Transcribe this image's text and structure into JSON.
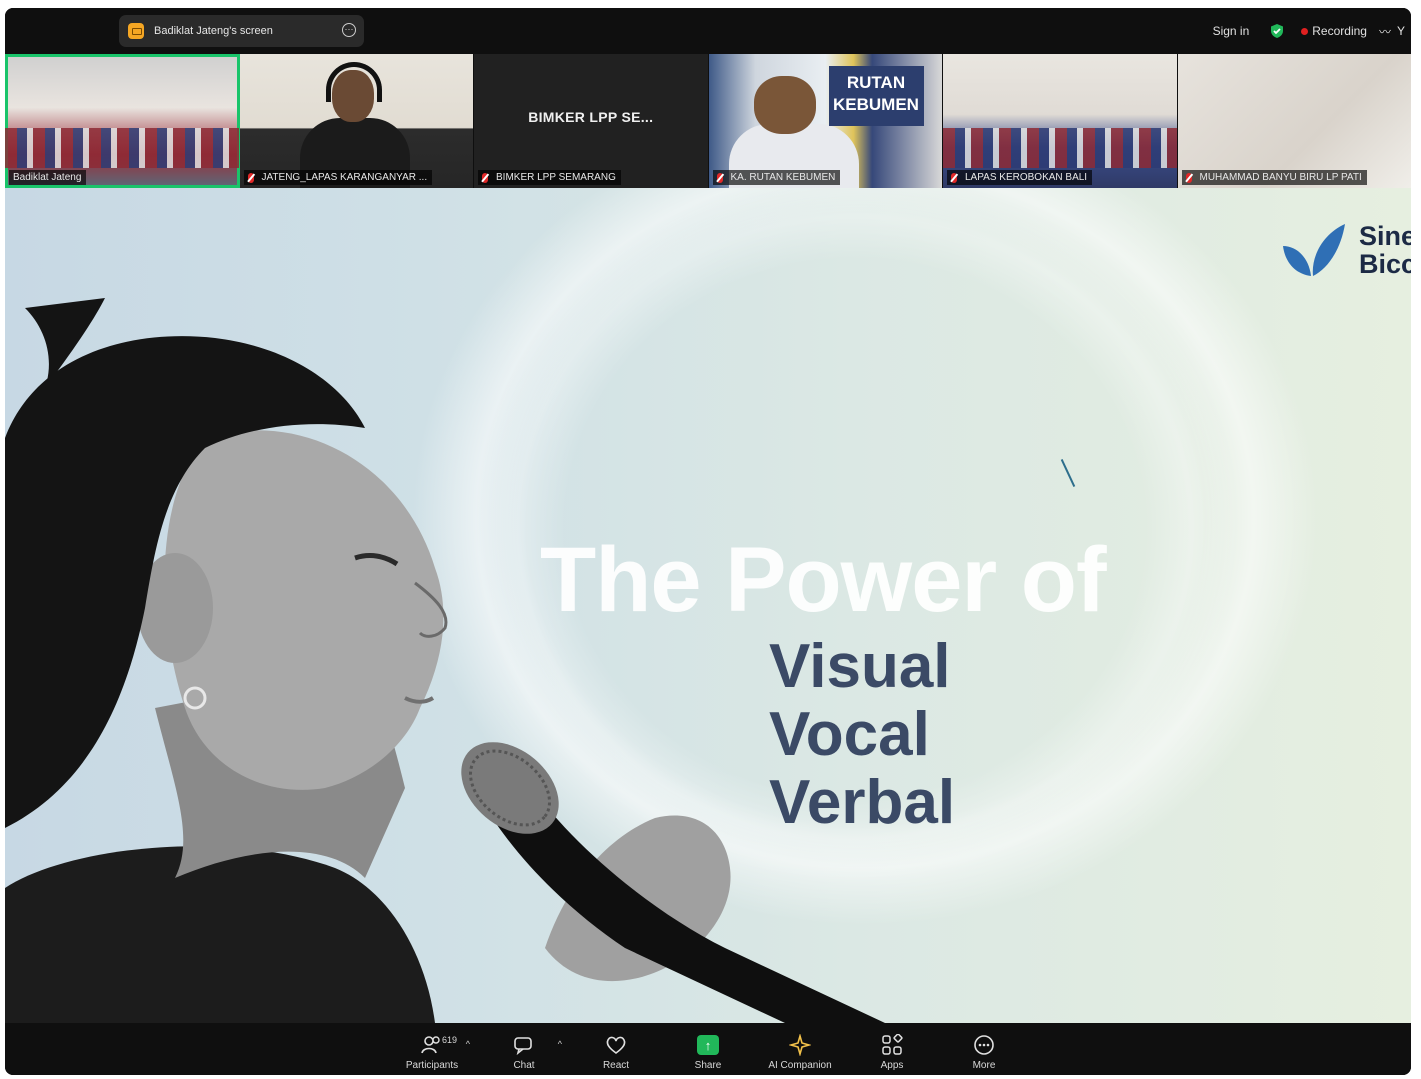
{
  "topbar": {
    "share_label": "Badiklat Jateng's screen",
    "sign_in": "Sign in",
    "recording": "Recording",
    "truncated_right": "Y"
  },
  "participants": [
    {
      "name": "Badiklat Jateng",
      "active": true
    },
    {
      "name": "JATENG_LAPAS KARANGANYAR ..."
    },
    {
      "name": "BIMKER LPP SEMARANG",
      "center_label": "BIMKER LPP SE..."
    },
    {
      "name": "KA. RUTAN KEBUMEN",
      "sign_text": "RUTAN KEBUMEN"
    },
    {
      "name": "LAPAS KEROBOKAN BALI"
    },
    {
      "name": "MUHAMMAD BANYU BIRU LP PATI"
    }
  ],
  "slide": {
    "logo_text_line1": "Sine",
    "logo_text_line2": "Bicc",
    "headline": "The Power of",
    "items": [
      "Visual",
      "Vocal",
      "Verbal"
    ],
    "colors": {
      "headline": "#ffffff",
      "items": "#3b4a66",
      "logo": "#2f6fb5"
    }
  },
  "toolbar": {
    "participants_label": "Participants",
    "participants_count": "619",
    "chat_label": "Chat",
    "react_label": "React",
    "share_label": "Share",
    "ai_label": "AI Companion",
    "apps_label": "Apps",
    "more_label": "More",
    "share_color": "#21b85a"
  }
}
